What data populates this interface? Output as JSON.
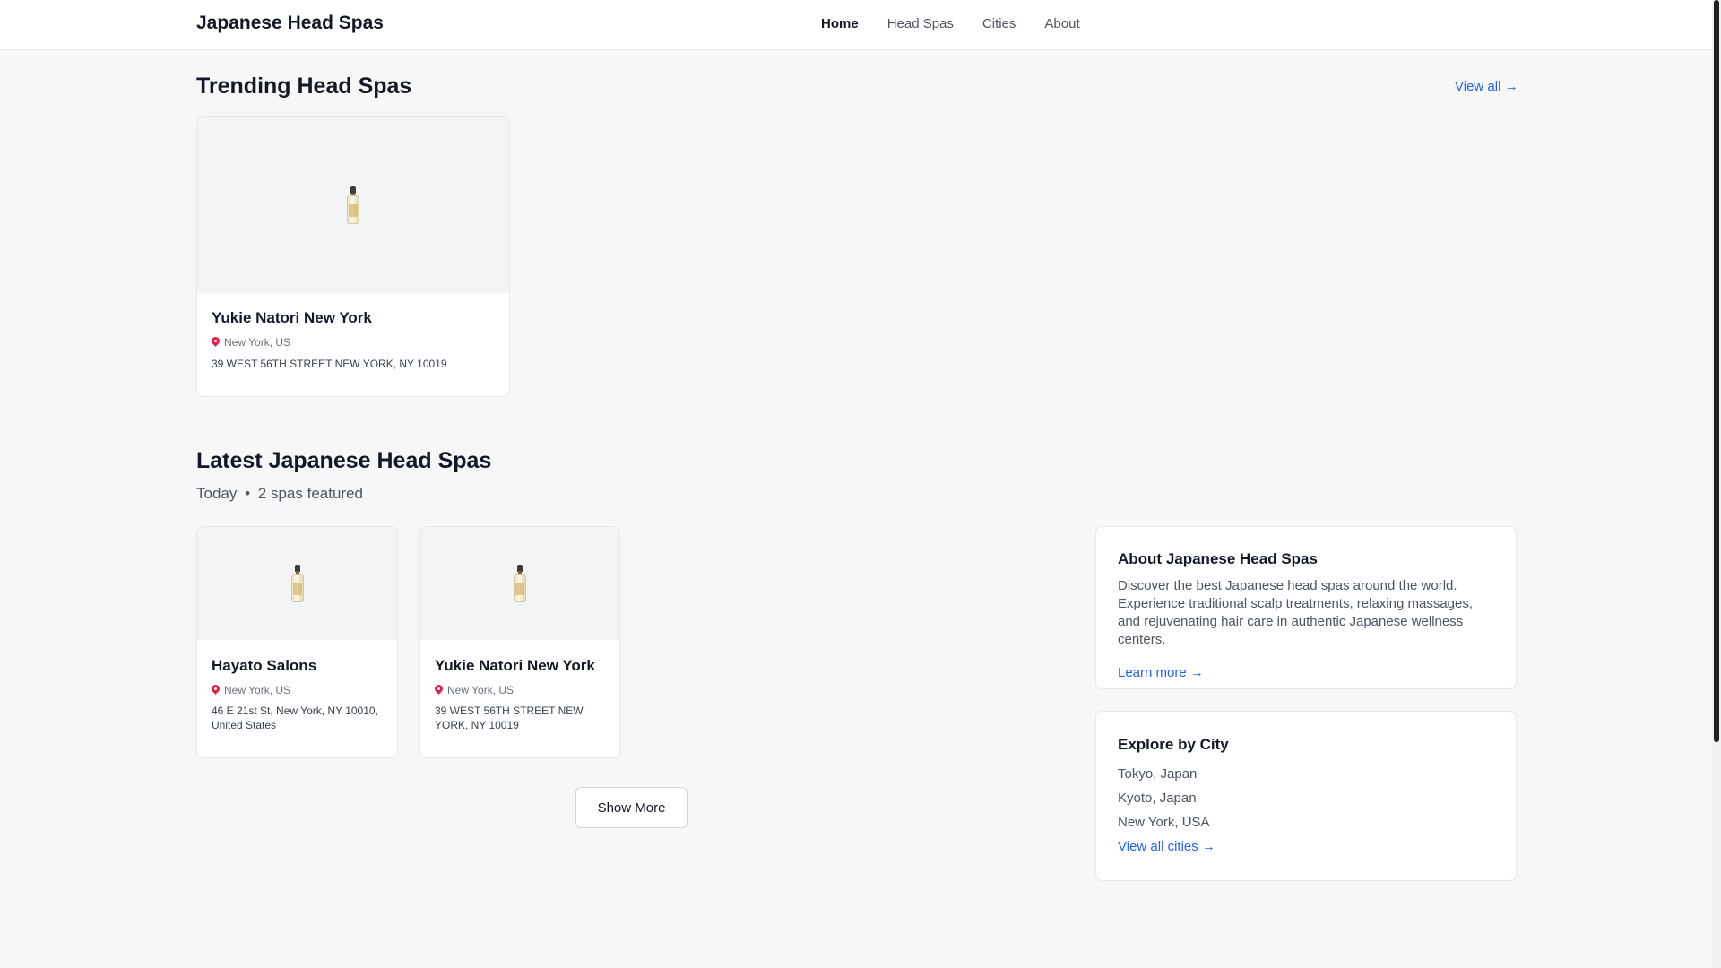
{
  "header": {
    "brand": "Japanese Head Spas",
    "nav": [
      "Home",
      "Head Spas",
      "Cities",
      "About"
    ]
  },
  "trending": {
    "title": "Trending Head Spas",
    "view_all": "View all →",
    "cards": [
      {
        "name": "Yukie Natori New York",
        "location": "New York, US",
        "address": "39 WEST 56TH STREET NEW YORK, NY 10019"
      }
    ]
  },
  "latest": {
    "title": "Latest Japanese Head Spas",
    "subtitle_day": "Today",
    "subtitle_sep": "•",
    "subtitle_count": "2 spas featured",
    "cards": [
      {
        "name": "Hayato Salons",
        "location": "New York, US",
        "address": "46 E 21st St, New York, NY 10010, United States"
      },
      {
        "name": "Yukie Natori New York",
        "location": "New York, US",
        "address": "39 WEST 56TH STREET NEW YORK, NY 10019"
      }
    ],
    "show_more": "Show More"
  },
  "about_panel": {
    "title": "About Japanese Head Spas",
    "text": "Discover the best Japanese head spas around the world. Experience traditional scalp treatments, relaxing massages, and rejuvenating hair care in authentic Japanese wellness centers.",
    "link": "Learn more →"
  },
  "cities_panel": {
    "title": "Explore by City",
    "cities": [
      "Tokyo, Japan",
      "Kyoto, Japan",
      "New York, USA"
    ],
    "link": "View all cities →"
  },
  "icons": {
    "spa": "spa-bottle-icon",
    "location": "location-pin-icon"
  }
}
